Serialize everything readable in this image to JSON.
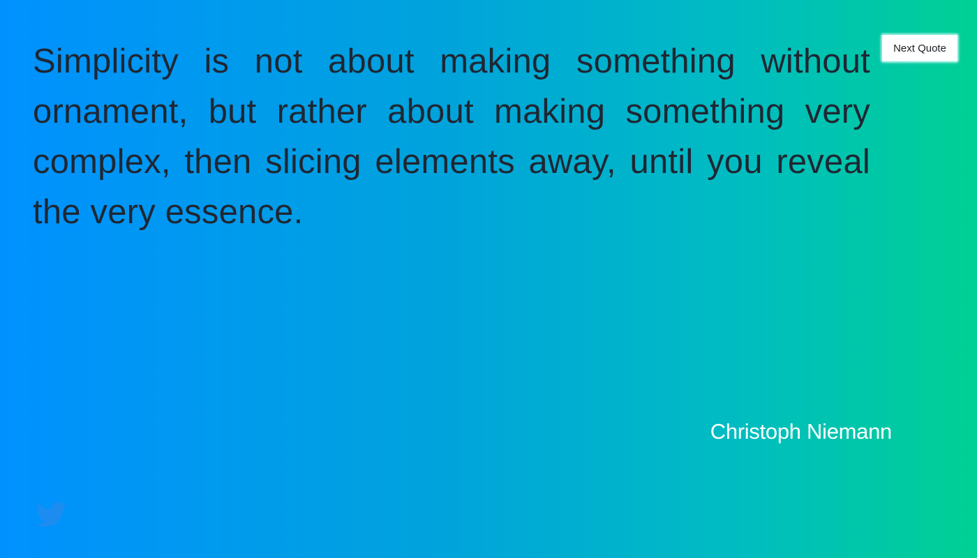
{
  "quote": {
    "text": "Simplicity is not about making something without ornament, but rather about making something very complex, then slicing elements away, until you reveal the very essence.",
    "author": "Christoph Niemann"
  },
  "controls": {
    "next_quote_label": "Next Quote"
  },
  "share": {
    "icon": "twitter-icon"
  },
  "colors": {
    "gradient_start": "#0091ff",
    "gradient_end": "#00d093",
    "quote_text": "#1f2733",
    "author_text": "#ffffff",
    "twitter_icon": "#1d8cf0",
    "button_border": "#78e8d6"
  }
}
